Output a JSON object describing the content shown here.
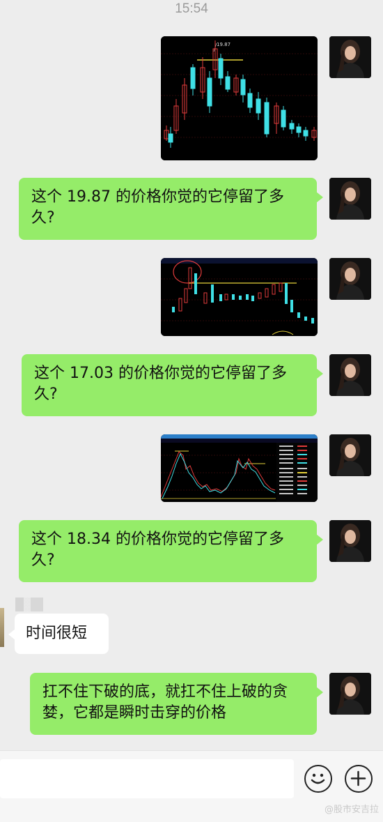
{
  "status_bar": {
    "time": "15:54"
  },
  "messages": [
    {
      "type": "image",
      "sender": "me",
      "chart_label": "19.87"
    },
    {
      "type": "text",
      "sender": "me",
      "text": "这个 19.87 的价格你觉的它停留了多久?"
    },
    {
      "type": "image",
      "sender": "me"
    },
    {
      "type": "text",
      "sender": "me",
      "text": "这个 17.03 的价格你觉的它停留了多久?"
    },
    {
      "type": "image",
      "sender": "me"
    },
    {
      "type": "text",
      "sender": "me",
      "text": "这个 18.34 的价格你觉的它停留了多久?"
    },
    {
      "type": "text",
      "sender": "other",
      "text": "时间很短"
    },
    {
      "type": "text",
      "sender": "me",
      "text": "扛不住下破的底，就扛不住上破的贪婪，它都是瞬时击穿的价格"
    }
  ],
  "input_bar": {
    "emoji_icon": "emoji-icon",
    "plus_icon": "plus-icon"
  },
  "watermark": "@股市安吉拉",
  "colors": {
    "bubble_me": "#95ec69",
    "bubble_other": "#ffffff",
    "background": "#ededed",
    "candle_up": "#e23b3b",
    "candle_down": "#3fe0e6"
  }
}
